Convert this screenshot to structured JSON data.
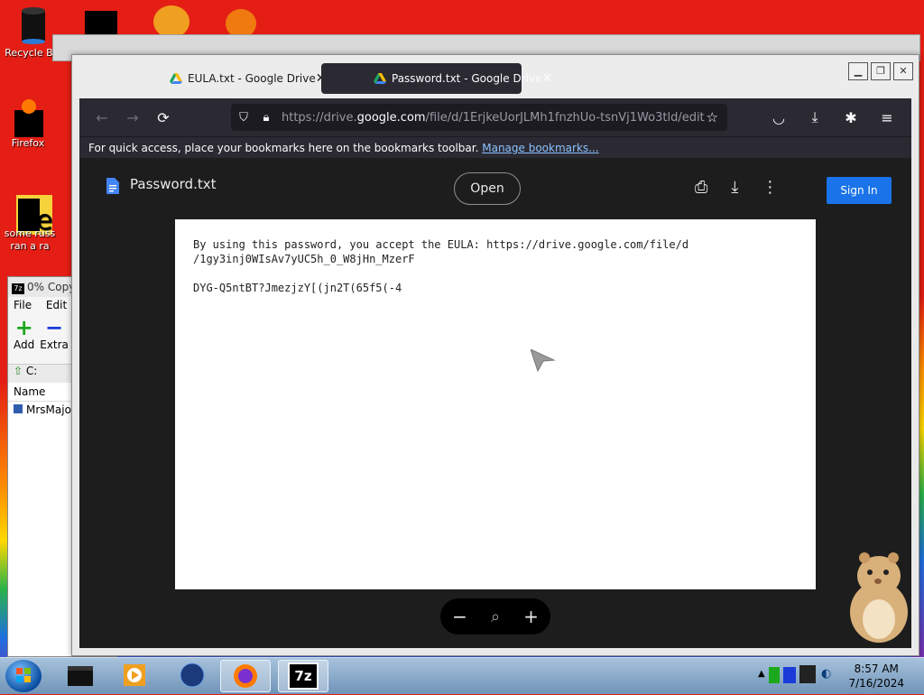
{
  "desktop": {
    "icons": [
      {
        "label": "Recycle Bin"
      },
      {
        "label": "Firefox"
      },
      {
        "label": "some russ ran a ra"
      }
    ]
  },
  "sevenzip": {
    "title": "0% Copy",
    "menu": [
      "File",
      "Edit"
    ],
    "tools": [
      "Add",
      "Extra"
    ],
    "address": "C:",
    "column": "Name",
    "row": "MrsMajo"
  },
  "browser": {
    "tabs": [
      {
        "label": "EULA.txt - Google Drive",
        "close": "✕"
      },
      {
        "label": "Password.txt - Google Drive",
        "close": "✕"
      }
    ],
    "url": {
      "prefix": "https://drive.",
      "host": "google.com",
      "path": "/file/d/1ErjkeUorJLMh1fnzhUo-tsnVj1Wo3tld/edit"
    },
    "bookmarks_text": "For quick access, place your bookmarks here on the bookmarks toolbar.",
    "bookmarks_link": "Manage bookmarks..."
  },
  "viewer": {
    "file_title": "Password.txt",
    "open_label": "Open",
    "sign_in_label": "Sign In",
    "lines": [
      "By using this password, you accept the EULA: https://drive.google.com/file/d",
      "/1gy3inj0WIsAv7yUC5h_0_W8jHn_MzerF",
      "DYG-Q5ntBT?JmezjzY[(jn2T(65f5(-4"
    ],
    "zoom_out": "−",
    "zoom_in": "+"
  },
  "taskbar": {
    "time": "8:57 AM",
    "date": "7/16/2024",
    "sevenzip_label": "7z"
  },
  "colors": {
    "accent": "#1a73e8",
    "dark_tab": "#2b2a33",
    "link": "#8bc2ff"
  }
}
